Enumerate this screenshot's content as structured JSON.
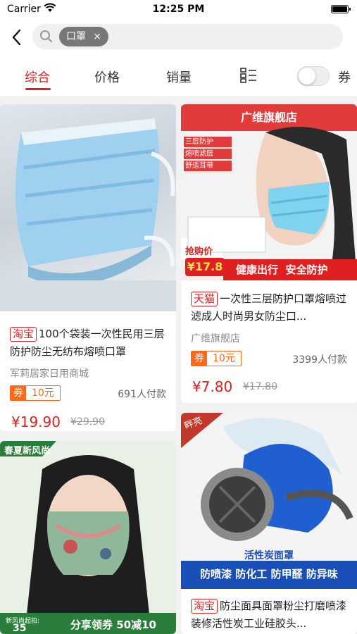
{
  "status": {
    "carrier": "Carrier",
    "time": "12:25 PM"
  },
  "search": {
    "chip": "口罩",
    "chip_close": "×"
  },
  "sort": {
    "items": [
      "综合",
      "价格",
      "销量"
    ],
    "coupon_toggle_label": "券",
    "coupon_toggle_on": false
  },
  "products": [
    {
      "platform": "淘宝",
      "title": "100个袋装一次性民用三层防护防尘无纺布熔喷口罩",
      "shop": "军莉居家日用商城",
      "coupon_key": "券",
      "coupon": "10元",
      "sales": "691人付款",
      "price": "¥19.90",
      "original_price": "¥29.90"
    },
    {
      "platform": "天猫",
      "title": "一次性三层防护口罩熔喷过滤成人时尚男女防尘口...",
      "shop": "广维旗舰店",
      "coupon_key": "券",
      "coupon": "10元",
      "sales": "3399人付款",
      "price": "¥7.80",
      "original_price": "¥17.80",
      "image_text": {
        "banner": "广维旗舰店",
        "tags": [
          "三层防护",
          "熔喷滤层",
          "舒适耳带"
        ],
        "promo_label": "抢购价",
        "promo_price": "¥17.8",
        "slogan": "健康出行  安全防护"
      }
    },
    {
      "image_text": {
        "corner": "春夏新风尚",
        "promo": "分享领券 50减10",
        "footer_label": "新风尚起拍:",
        "footer_value": "35"
      }
    },
    {
      "platform": "淘宝",
      "title": "防尘面具面罩粉尘打磨喷漆装修活性炭工业硅胶头...",
      "image_text": {
        "ribbon": "畔亮",
        "caption": "活性炭面罩",
        "features": "防喷漆 防化工 防甲醛 防异味"
      }
    }
  ],
  "colors": {
    "accent": "#e02020",
    "coupon": "#ff6a1a"
  }
}
